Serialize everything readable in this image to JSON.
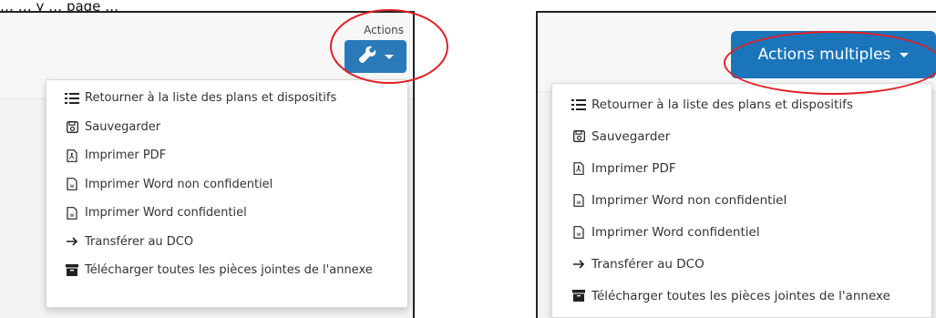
{
  "page_fragment": "… … y … page …",
  "left": {
    "actions_label": "Actions",
    "button_icon": "wrench-icon",
    "menu": [
      {
        "icon": "list-icon",
        "label": "Retourner à la liste des plans et dispositifs"
      },
      {
        "icon": "save-icon",
        "label": "Sauvegarder"
      },
      {
        "icon": "pdf-icon",
        "label": "Imprimer PDF"
      },
      {
        "icon": "word-icon",
        "label": "Imprimer Word non confidentiel"
      },
      {
        "icon": "word-icon",
        "label": "Imprimer Word confidentiel"
      },
      {
        "icon": "arrow-right-icon",
        "label": "Transférer au DCO"
      },
      {
        "icon": "archive-icon",
        "label": "Télécharger toutes les pièces jointes de l'annexe"
      }
    ]
  },
  "right": {
    "button_label": "Actions multiples",
    "menu": [
      {
        "icon": "list-icon",
        "label": "Retourner à la liste des plans et dispositifs"
      },
      {
        "icon": "save-icon",
        "label": "Sauvegarder"
      },
      {
        "icon": "pdf-icon",
        "label": "Imprimer PDF"
      },
      {
        "icon": "word-icon",
        "label": "Imprimer Word non confidentiel"
      },
      {
        "icon": "word-icon",
        "label": "Imprimer Word confidentiel"
      },
      {
        "icon": "arrow-right-icon",
        "label": "Transférer au DCO"
      },
      {
        "icon": "archive-icon",
        "label": "Télécharger toutes les pièces jointes de l'annexe"
      }
    ]
  },
  "colors": {
    "primary_button": "#2a7ab9",
    "highlight": "#e31e24"
  }
}
